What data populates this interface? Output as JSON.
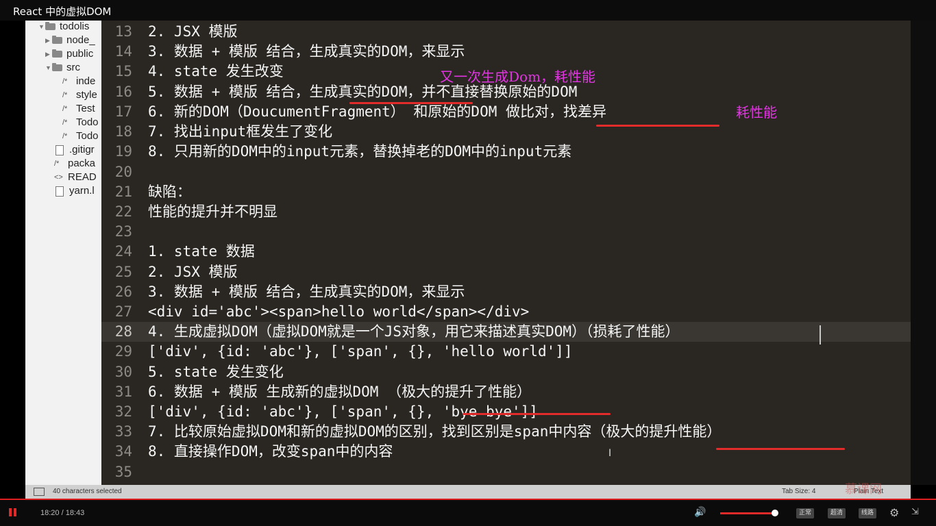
{
  "window": {
    "title": "React 中的虚拟DOM"
  },
  "sidebar": {
    "items": [
      {
        "label": "todolis",
        "type": "folder-open"
      },
      {
        "label": "node_",
        "type": "folder-closed"
      },
      {
        "label": "public",
        "type": "folder-closed"
      },
      {
        "label": "src",
        "type": "folder-open"
      },
      {
        "label": "inde",
        "type": "file-comment"
      },
      {
        "label": "style",
        "type": "file-comment"
      },
      {
        "label": "Test",
        "type": "file-comment"
      },
      {
        "label": "Todo",
        "type": "file-comment"
      },
      {
        "label": "Todo",
        "type": "file-comment"
      },
      {
        "label": ".gitigr",
        "type": "file"
      },
      {
        "label": "packa",
        "type": "file-comment"
      },
      {
        "label": "READ",
        "type": "file-code"
      },
      {
        "label": "yarn.l",
        "type": "file"
      }
    ]
  },
  "editor": {
    "lines": [
      {
        "num": "13",
        "text": "2. JSX 模版"
      },
      {
        "num": "14",
        "text": "3. 数据 + 模版 结合，生成真实的DOM，来显示"
      },
      {
        "num": "15",
        "text": "4. state 发生改变"
      },
      {
        "num": "16",
        "text": "5. 数据 + 模版 结合，生成真实的DOM，并不直接替换原始的DOM"
      },
      {
        "num": "17",
        "text": "6. 新的DOM（DoucumentFragment） 和原始的DOM 做比对，找差异"
      },
      {
        "num": "18",
        "text": "7. 找出input框发生了变化"
      },
      {
        "num": "19",
        "text": "8. 只用新的DOM中的input元素，替换掉老的DOM中的input元素"
      },
      {
        "num": "20",
        "text": ""
      },
      {
        "num": "21",
        "text": "缺陷："
      },
      {
        "num": "22",
        "text": "性能的提升并不明显"
      },
      {
        "num": "23",
        "text": ""
      },
      {
        "num": "24",
        "text": "1. state 数据"
      },
      {
        "num": "25",
        "text": "2. JSX 模版"
      },
      {
        "num": "26",
        "text": "3. 数据 + 模版 结合，生成真实的DOM，来显示"
      },
      {
        "num": "27",
        "text": "<div id='abc'><span>hello world</span></div>"
      },
      {
        "num": "28",
        "text": "4. 生成虚拟DOM（虚拟DOM就是一个JS对象，用它来描述真实DOM）（损耗了性能）"
      },
      {
        "num": "29",
        "text": "['div', {id: 'abc'}, ['span', {}, 'hello world']]"
      },
      {
        "num": "30",
        "text": "5. state 发生变化"
      },
      {
        "num": "31",
        "text": "6. 数据 + 模版 生成新的虚拟DOM （极大的提升了性能）"
      },
      {
        "num": "32",
        "text": "['div', {id: 'abc'}, ['span', {}, 'bye bye']]"
      },
      {
        "num": "33",
        "text": "7. 比较原始虚拟DOM和新的虚拟DOM的区别，找到区别是span中内容（极大的提升性能）"
      },
      {
        "num": "34",
        "text": "8. 直接操作DOM，改变span中的内容"
      },
      {
        "num": "35",
        "text": ""
      }
    ],
    "highlighted_line": "28",
    "annotations": {
      "a1": "又一次生成Dom，耗性能",
      "a2": "耗性能"
    },
    "accent_color": "#e234e2",
    "underline_color": "#e22b2b"
  },
  "statusbar": {
    "selection": "40 characters selected",
    "tab_size": "Tab Size: 4",
    "syntax": "Plain Text"
  },
  "watermark": "慕课网",
  "player": {
    "time": "18:20 / 18:43",
    "quality_options": [
      "正常",
      "超清",
      "线路"
    ]
  }
}
